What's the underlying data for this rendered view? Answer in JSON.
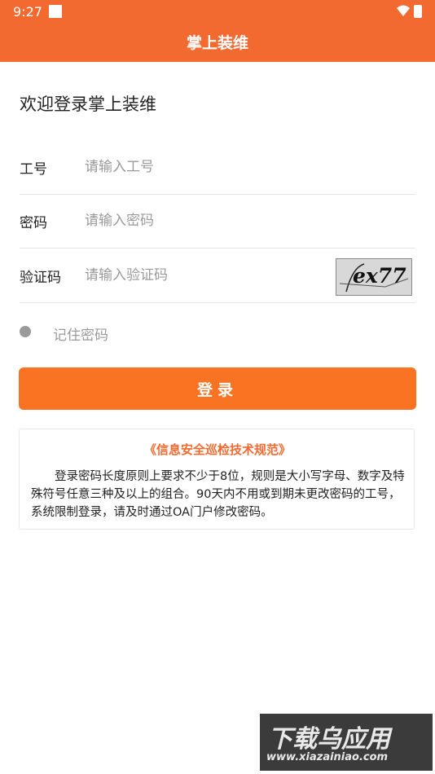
{
  "status_bar": {
    "time": "9:27"
  },
  "header": {
    "title": "掌上装维"
  },
  "welcome": "欢迎登录掌上装维",
  "form": {
    "employee_id": {
      "label": "工号",
      "placeholder": "请输入工号",
      "value": ""
    },
    "password": {
      "label": "密码",
      "placeholder": "请输入密码",
      "value": ""
    },
    "captcha": {
      "label": "验证码",
      "placeholder": "请输入验证码",
      "value": "",
      "image_text": "ex77"
    },
    "remember_label": "记住密码",
    "login_button": "登录"
  },
  "notice": {
    "title": "《信息安全巡检技术规范》",
    "body": "登录密码长度原则上要求不少于8位，规则是大小写字母、数字及特殊符号任意三种及以上的组合。90天内不用或到期未更改密码的工号，系统限制登录，请及时通过OA门户修改密码。"
  },
  "watermark": {
    "text": "下载乌应用",
    "url": "www.xiazainiao.com"
  },
  "colors": {
    "primary": "#f36a31",
    "button": "#f97323",
    "placeholder": "#9a9a9a"
  }
}
